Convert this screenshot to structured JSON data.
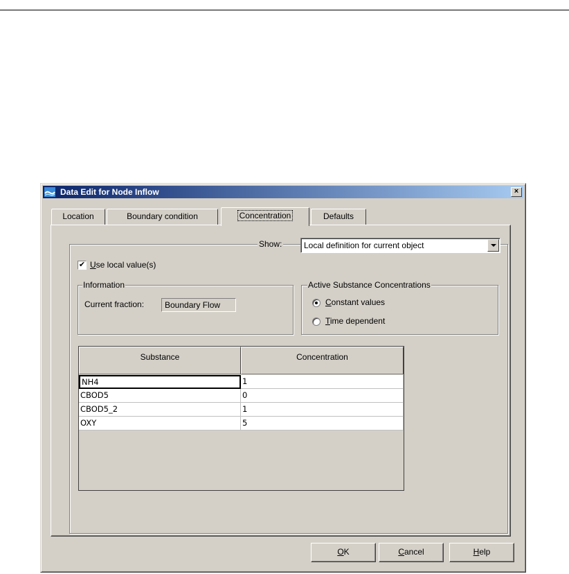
{
  "dialog": {
    "title": "Data Edit for Node Inflow",
    "close_glyph": "×"
  },
  "tabs": [
    {
      "label": "Location",
      "active": false
    },
    {
      "label": "Boundary condition",
      "active": false
    },
    {
      "label": "Concentration",
      "active": true
    },
    {
      "label": "Defaults",
      "active": false
    }
  ],
  "show": {
    "label": "Show:",
    "selected": "Local definition for current object"
  },
  "use_local": {
    "checked": true,
    "label_access": "U",
    "label_rest": "se local value(s)"
  },
  "information": {
    "title": "Information",
    "fraction_label": "Current fraction:",
    "fraction_value": "Boundary Flow"
  },
  "active_substance": {
    "title": "Active Substance Concentrations",
    "options": [
      {
        "access": "C",
        "rest": "onstant values",
        "selected": true
      },
      {
        "access": "T",
        "rest": "ime dependent",
        "selected": false
      }
    ]
  },
  "table": {
    "columns": [
      "Substance",
      "Concentration"
    ],
    "rows": [
      [
        "NH4",
        "1"
      ],
      [
        "CBOD5",
        "0"
      ],
      [
        "CBOD5_2",
        "1"
      ],
      [
        "OXY",
        "5"
      ]
    ]
  },
  "buttons": {
    "ok_access": "O",
    "ok_rest": "K",
    "cancel_access": "C",
    "cancel_rest": "ancel",
    "help_access": "H",
    "help_rest": "elp"
  },
  "colors": {
    "face": "#d4d0c8",
    "title_start": "#0a246a",
    "title_end": "#a6caf0"
  }
}
